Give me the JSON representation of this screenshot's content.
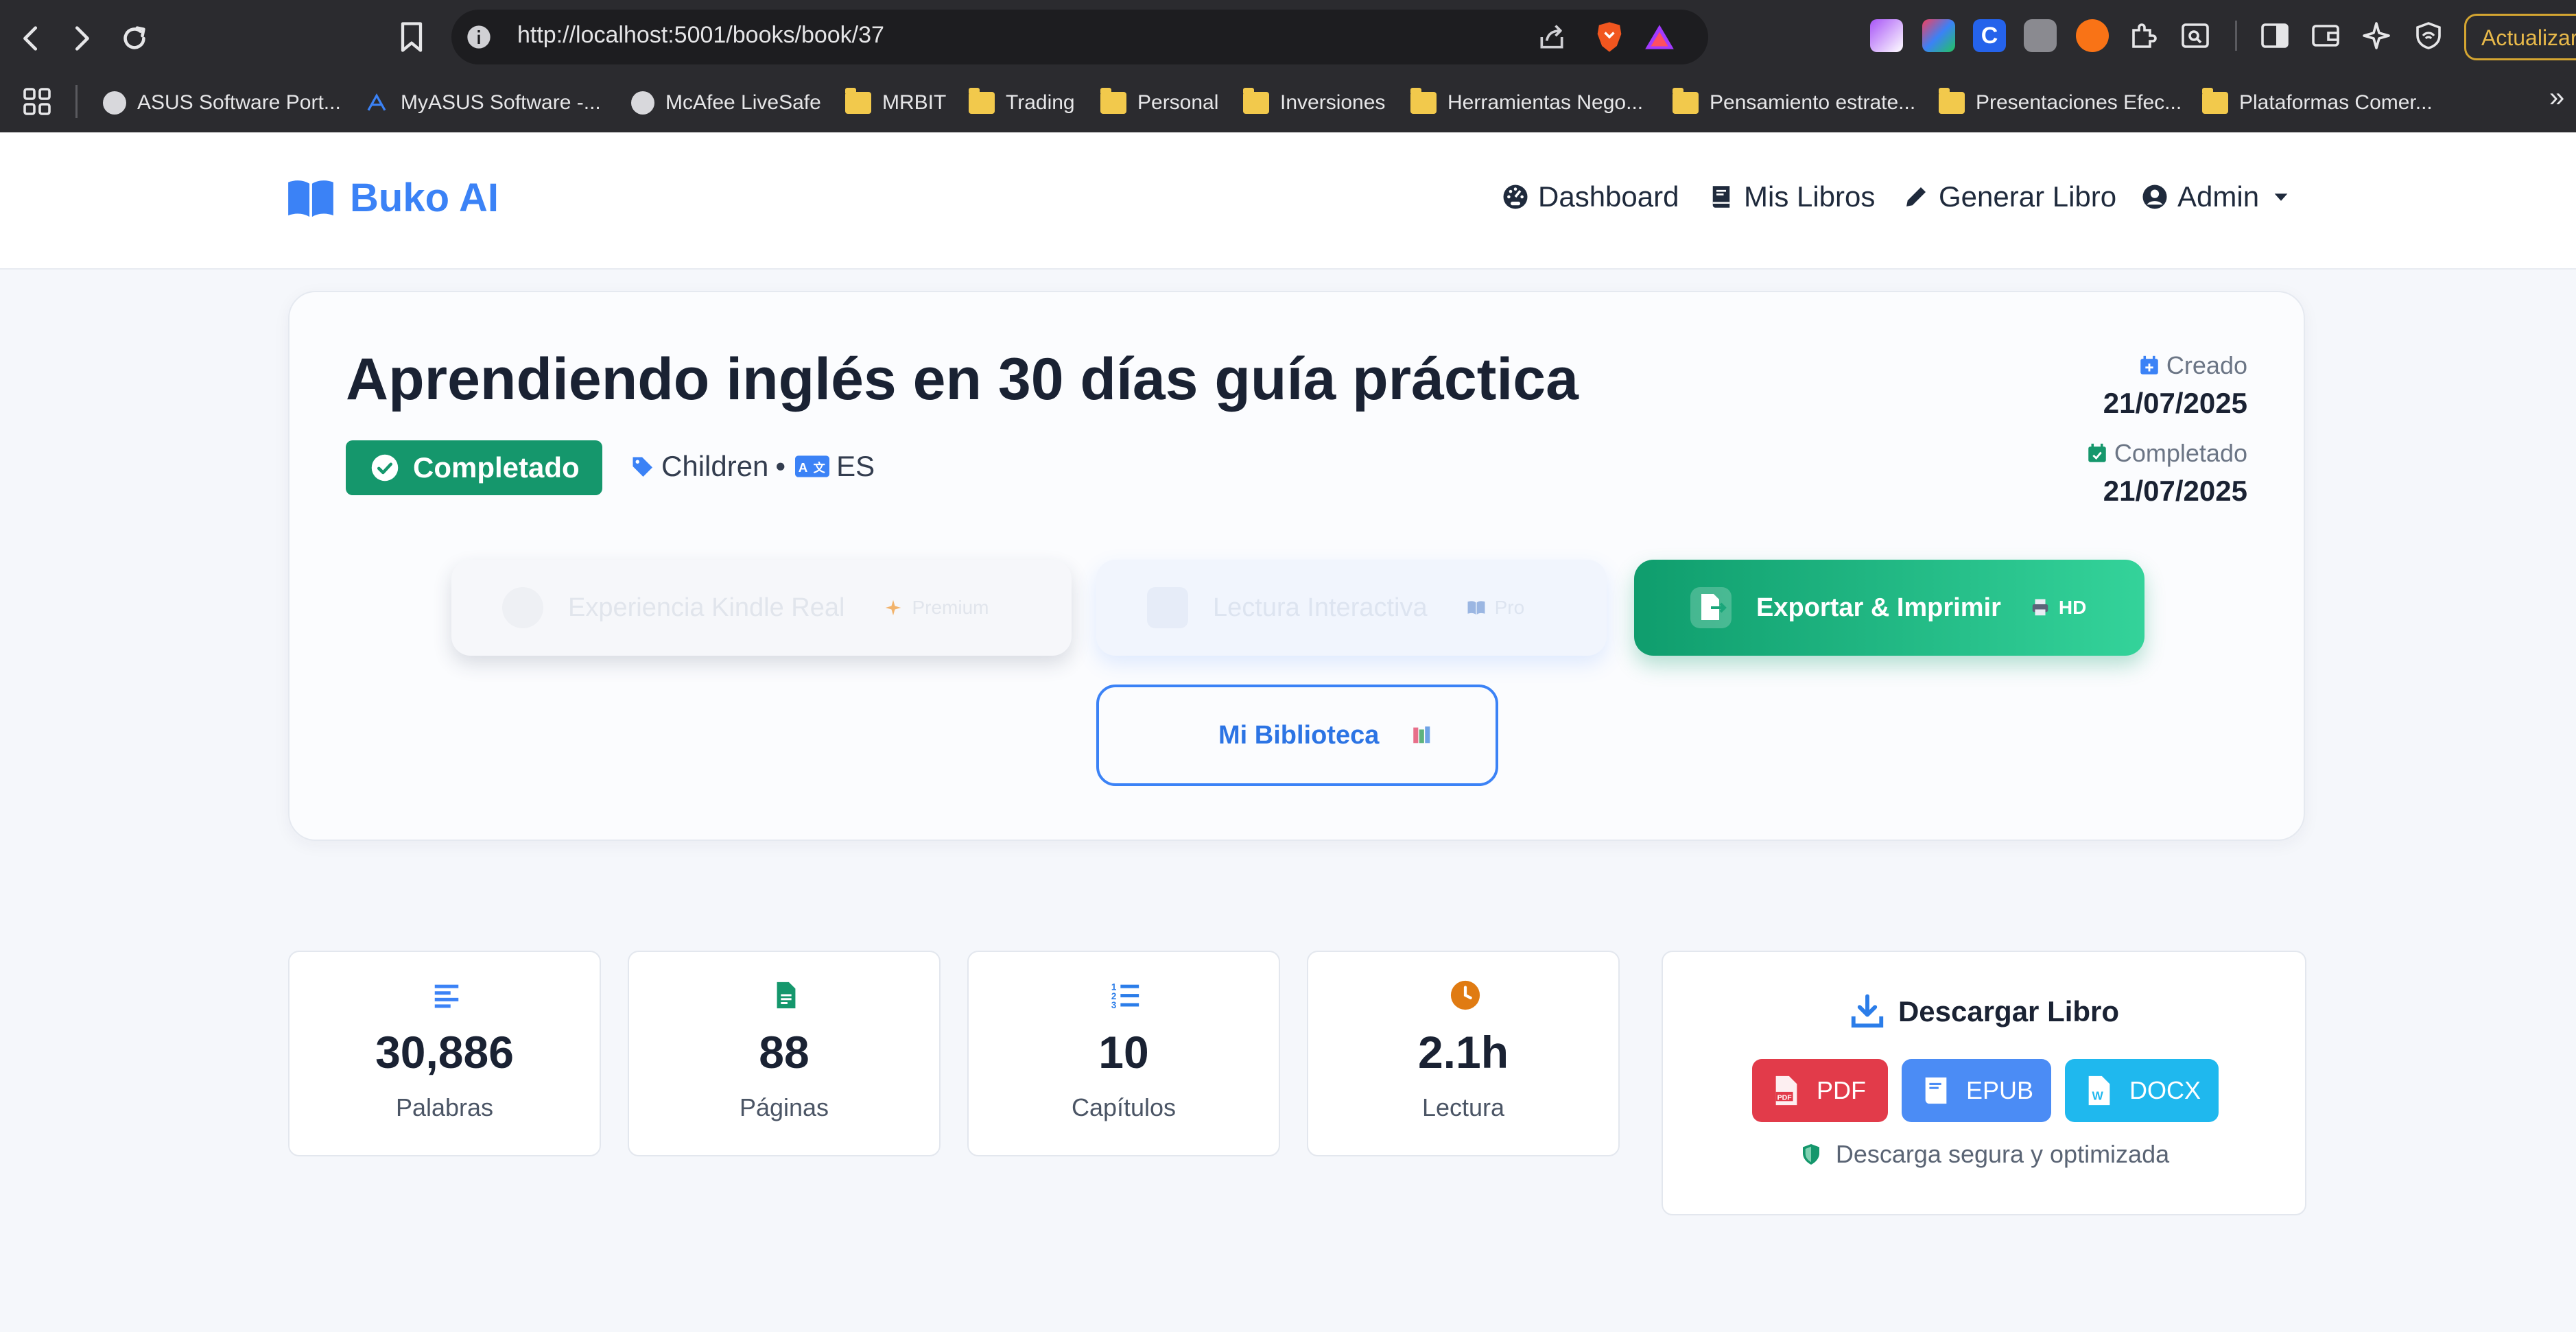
{
  "browser": {
    "url": "http://localhost:5001/books/book/37",
    "update_label": "Actualizar",
    "bookmarks": [
      {
        "label": "ASUS Software Port...",
        "icon": "globe-icon"
      },
      {
        "label": "MyASUS Software -...",
        "icon": "myasus-icon"
      },
      {
        "label": "McAfee LiveSafe",
        "icon": "globe-icon"
      },
      {
        "label": "MRBIT",
        "icon": "folder-icon"
      },
      {
        "label": "Trading",
        "icon": "folder-icon"
      },
      {
        "label": "Personal",
        "icon": "folder-icon"
      },
      {
        "label": "Inversiones",
        "icon": "folder-icon"
      },
      {
        "label": "Herramientas Nego...",
        "icon": "folder-icon"
      },
      {
        "label": "Pensamiento estrate...",
        "icon": "folder-icon"
      },
      {
        "label": "Presentaciones Efec...",
        "icon": "folder-icon"
      },
      {
        "label": "Plataformas Comer...",
        "icon": "folder-icon"
      }
    ],
    "overflow": "»"
  },
  "navbar": {
    "brand": "Buko AI",
    "links": [
      {
        "label": "Dashboard",
        "icon": "dashboard-icon"
      },
      {
        "label": "Mis Libros",
        "icon": "book-icon"
      },
      {
        "label": "Generar Libro",
        "icon": "pencil-icon"
      },
      {
        "label": "Admin",
        "icon": "user-icon"
      }
    ]
  },
  "book": {
    "title": "Aprendiendo inglés en 30 días guía práctica",
    "status": "Completado",
    "category": "Children",
    "separator": "•",
    "language": "ES",
    "created_label": "Creado",
    "created_date": "21/07/2025",
    "completed_label": "Completado",
    "completed_date": "21/07/2025"
  },
  "actions": {
    "kindle": {
      "label": "Experiencia Kindle Real",
      "tag": "Premium"
    },
    "lectura": {
      "label": "Lectura Interactiva",
      "tag": "Pro"
    },
    "export": {
      "label": "Exportar & Imprimir",
      "tag": "HD"
    },
    "biblioteca": {
      "label": "Mi Biblioteca"
    }
  },
  "stats": [
    {
      "value": "30,886",
      "label": "Palabras",
      "icon": "align-left-icon",
      "color": "#3b82f6"
    },
    {
      "value": "88",
      "label": "Páginas",
      "icon": "file-icon",
      "color": "#15976c"
    },
    {
      "value": "10",
      "label": "Capítulos",
      "icon": "list-ol-icon",
      "color": "#2b7de9"
    },
    {
      "value": "2.1h",
      "label": "Lectura",
      "icon": "clock-icon",
      "color": "#e07b12"
    }
  ],
  "download": {
    "title": "Descargar Libro",
    "pdf": "PDF",
    "epub": "EPUB",
    "docx": "DOCX",
    "note": "Descarga segura y optimizada"
  },
  "colors": {
    "primary": "#3b82f6",
    "success": "#15976c",
    "danger": "#e23b4a",
    "info": "#1fb8ee"
  }
}
